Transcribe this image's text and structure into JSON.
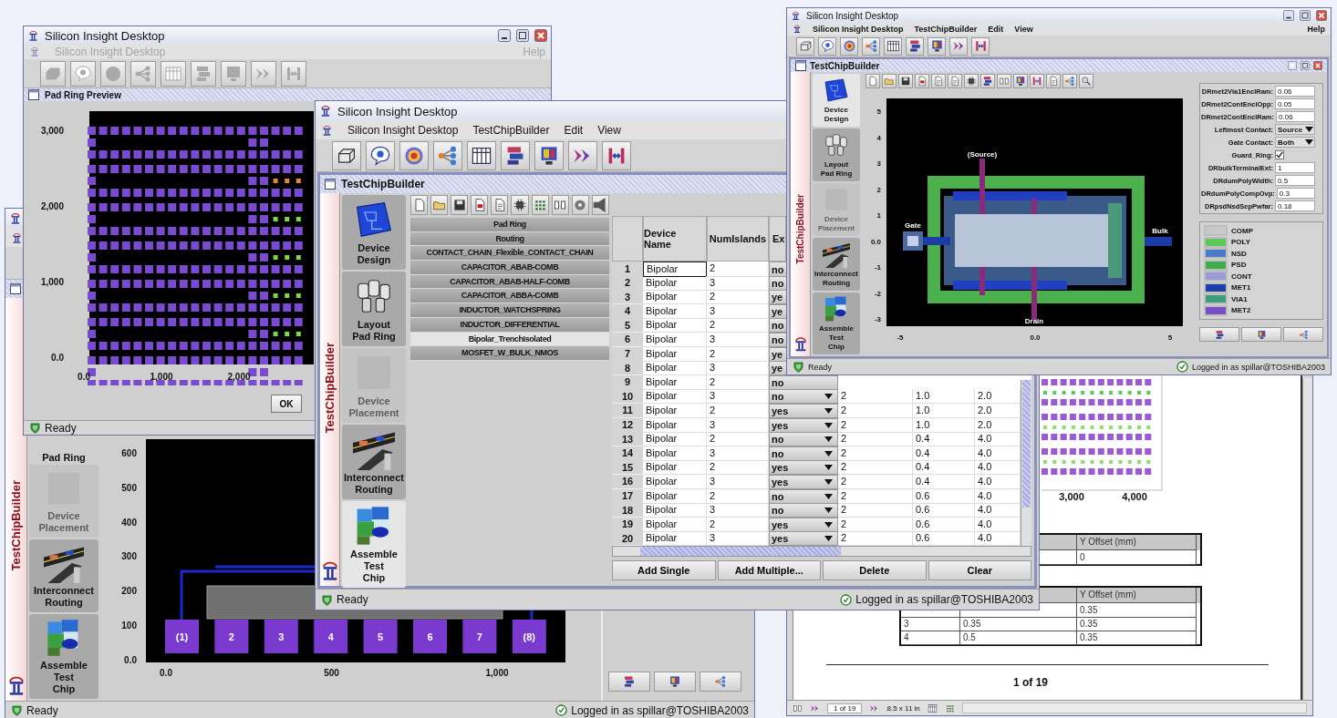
{
  "preview_window": {
    "title": "Silicon Insight Desktop",
    "menubar": {
      "items": [
        "Silicon Insight Desktop"
      ],
      "help": "Help",
      "disabled": true
    },
    "frame_title": "Pad Ring Preview",
    "plot": {
      "yticks": [
        "3,000",
        "2,000",
        "1,000",
        "0.0"
      ],
      "xticks": [
        "0.0",
        "1,000",
        "2,000"
      ]
    },
    "ok": "OK",
    "status": "Ready"
  },
  "builder_window": {
    "title": "Silicon Insight Desktop",
    "menubar": {
      "items": [
        "Silicon Insight Desktop",
        "TestChipBuilder",
        "Edit",
        "View"
      ]
    },
    "frame_title": "TestChipBuilder",
    "sidebar_title": "TestChipBuilder",
    "nav": [
      {
        "kind": "design",
        "label": "Device\nDesign",
        "selected": false,
        "disabled": false
      },
      {
        "kind": "padring",
        "label": "Layout\nPad Ring",
        "selected": false,
        "disabled": false
      },
      {
        "kind": "placement",
        "label": "Device\nPlacement",
        "selected": false,
        "disabled": true
      },
      {
        "kind": "routing",
        "label": "Interconnect\nRouting",
        "selected": false,
        "disabled": false
      },
      {
        "kind": "assembly",
        "label": "Assemble\nTest\nChip",
        "selected": true,
        "disabled": false
      }
    ],
    "device_list": [
      {
        "label": "Pad Ring",
        "selected": false
      },
      {
        "label": "Routing",
        "selected": false
      },
      {
        "label": "CONTACT_CHAIN_Flexible_CONTACT_CHAIN",
        "selected": false
      },
      {
        "label": "CAPACITOR_ABAB-COMB",
        "selected": false
      },
      {
        "label": "CAPACITOR_ABAB-HALF-COMB",
        "selected": false
      },
      {
        "label": "CAPACITOR_ABBA-COMB",
        "selected": false
      },
      {
        "label": "INDUCTOR_WATCHSPRING",
        "selected": false
      },
      {
        "label": "INDUCTOR_DIFFERENTIAL",
        "selected": false
      },
      {
        "label": "Bipolar_TrenchIsolated",
        "selected": true
      },
      {
        "label": "MOSFET_W_BULK_NMOS",
        "selected": false
      }
    ],
    "table": {
      "columns": [
        "Device Name",
        "NumIslands",
        "Ex"
      ],
      "rows": [
        {
          "index": "1",
          "cells": [
            "Bipolar",
            "2",
            "no"
          ],
          "focused": true
        },
        {
          "index": "2",
          "cells": [
            "Bipolar",
            "3",
            "no"
          ],
          "focused": false
        },
        {
          "index": "3",
          "cells": [
            "Bipolar",
            "2",
            "ye"
          ],
          "focused": false
        },
        {
          "index": "4",
          "cells": [
            "Bipolar",
            "3",
            "ye"
          ],
          "focused": false
        },
        {
          "index": "5",
          "cells": [
            "Bipolar",
            "2",
            "no"
          ],
          "focused": false
        },
        {
          "index": "6",
          "cells": [
            "Bipolar",
            "3",
            "no"
          ],
          "focused": false
        },
        {
          "index": "7",
          "cells": [
            "Bipolar",
            "2",
            "ye"
          ],
          "focused": false
        },
        {
          "index": "8",
          "cells": [
            "Bipolar",
            "3",
            "ye"
          ],
          "focused": false
        },
        {
          "index": "9",
          "cells": [
            "Bipolar",
            "2",
            "no"
          ],
          "focused": false
        },
        {
          "index": "10",
          "cells": [
            "Bipolar",
            "3",
            "no",
            "2",
            "1.0",
            "2.0"
          ],
          "focused": false
        },
        {
          "index": "11",
          "cells": [
            "Bipolar",
            "2",
            "yes",
            "2",
            "1.0",
            "2.0"
          ],
          "focused": false
        },
        {
          "index": "12",
          "cells": [
            "Bipolar",
            "3",
            "yes",
            "2",
            "1.0",
            "2.0"
          ],
          "focused": false
        },
        {
          "index": "13",
          "cells": [
            "Bipolar",
            "2",
            "no",
            "2",
            "0.4",
            "4.0"
          ],
          "focused": false
        },
        {
          "index": "14",
          "cells": [
            "Bipolar",
            "3",
            "no",
            "2",
            "0.4",
            "4.0"
          ],
          "focused": false
        },
        {
          "index": "15",
          "cells": [
            "Bipolar",
            "2",
            "yes",
            "2",
            "0.4",
            "4.0"
          ],
          "focused": false
        },
        {
          "index": "16",
          "cells": [
            "Bipolar",
            "3",
            "yes",
            "2",
            "0.4",
            "4.0"
          ],
          "focused": false
        },
        {
          "index": "17",
          "cells": [
            "Bipolar",
            "2",
            "no",
            "2",
            "0.6",
            "4.0"
          ],
          "focused": false
        },
        {
          "index": "18",
          "cells": [
            "Bipolar",
            "3",
            "no",
            "2",
            "0.6",
            "4.0"
          ],
          "focused": false
        },
        {
          "index": "19",
          "cells": [
            "Bipolar",
            "2",
            "yes",
            "2",
            "0.6",
            "4.0"
          ],
          "focused": false
        },
        {
          "index": "20",
          "cells": [
            "Bipolar",
            "3",
            "yes",
            "2",
            "0.6",
            "4.0"
          ],
          "focused": false
        }
      ]
    },
    "buttons": [
      "Add Single",
      "Add Multiple...",
      "Delete",
      "Clear"
    ],
    "status": "Ready",
    "login": "Logged in as spillar@TOSHIBA2003"
  },
  "device_window": {
    "title": "Silicon Insight Desktop",
    "menubar": {
      "items": [
        "Silicon Insight Desktop",
        "TestChipBuilder",
        "Edit",
        "View"
      ],
      "help": "Help"
    },
    "frame_title": "TestChipBuilder",
    "sidebar_title": "TestChipBuilder",
    "nav": [
      {
        "kind": "design",
        "label": "Device\nDesign",
        "selected": true,
        "disabled": false
      },
      {
        "kind": "padring",
        "label": "Layout\nPad Ring",
        "selected": false,
        "disabled": false
      },
      {
        "kind": "placement",
        "label": "Device\nPlacement",
        "selected": false,
        "disabled": true
      },
      {
        "kind": "routing",
        "label": "Interconnect\nRouting",
        "selected": false,
        "disabled": false
      },
      {
        "kind": "assembly",
        "label": "Assemble\nTest\nChip",
        "selected": false,
        "disabled": false
      }
    ],
    "plot": {
      "yticks": [
        "5",
        "4",
        "3",
        "2",
        "1",
        "0.0",
        "-1",
        "-2",
        "-3"
      ],
      "xticks": [
        "-5",
        "0.0",
        "5"
      ],
      "terminals": [
        "(Source)",
        "Gate",
        "Bulk",
        "Drain"
      ]
    },
    "properties": [
      {
        "kind": "text",
        "label": "DRmet2Via1EnclRam:",
        "value": "0.06"
      },
      {
        "kind": "text",
        "label": "DRmet2ContEnclOpp:",
        "value": "0.05"
      },
      {
        "kind": "text",
        "label": "DRmet2ContEnclRam:",
        "value": "0.06"
      },
      {
        "kind": "choice",
        "label": "Leftmost Contact:",
        "value": "Source"
      },
      {
        "kind": "choice",
        "label": "Gate Contact:",
        "value": "Both"
      },
      {
        "kind": "check",
        "label": "Guard_Ring:",
        "checked": true
      },
      {
        "kind": "text",
        "label": "DRbulkTerminalExt:",
        "value": "1"
      },
      {
        "kind": "text",
        "label": "DRdumPolyWidth:",
        "value": "0.5"
      },
      {
        "kind": "text",
        "label": "DRdumPolyCompOvp:",
        "value": "0.3"
      },
      {
        "kind": "text",
        "label": "DRpsdNsdSepPwfar:",
        "value": "0.18"
      }
    ],
    "layers": [
      {
        "name": "COMP",
        "color": "#c8c8c8"
      },
      {
        "name": "POLY",
        "color": "#5cc85c"
      },
      {
        "name": "NSD",
        "color": "#4a7ac8"
      },
      {
        "name": "PSD",
        "color": "#3cae4c"
      },
      {
        "name": "CONT",
        "color": "#9a9ad8"
      },
      {
        "name": "MET1",
        "color": "#1c3ca8"
      },
      {
        "name": "VIA1",
        "color": "#3c9c7c"
      },
      {
        "name": "MET2",
        "color": "#7a4cc8"
      }
    ],
    "status": "Ready",
    "login": "Logged in as spillar@TOSHIBA2003"
  },
  "layout_window": {
    "sidebar_title": "TestChipBuilder",
    "nav_partial": "Pad Ring",
    "nav": [
      {
        "kind": "placement",
        "label": "Device\nPlacement",
        "selected": false,
        "disabled": true
      },
      {
        "kind": "routing",
        "label": "Interconnect\nRouting",
        "selected": false,
        "disabled": false
      },
      {
        "kind": "assembly",
        "label": "Assemble\nTest\nChip",
        "selected": false,
        "disabled": false
      }
    ],
    "plot": {
      "yticks": [
        "600",
        "500",
        "400",
        "300",
        "200",
        "100",
        "0.0"
      ],
      "xticks": [
        "0.0",
        "500",
        "1,000"
      ],
      "pads": [
        "(1)",
        "2",
        "3",
        "4",
        "5",
        "6",
        "7",
        "(8)"
      ]
    },
    "status": "Ready",
    "login": "Logged in as spillar@TOSHIBA2003"
  },
  "report_window": {
    "chart_labels": [
      "3,000",
      "4,000"
    ],
    "tables": [
      {
        "header": {
          "column_3": "Y Offset (mm)"
        },
        "rows": [
          {
            "column_3": "0"
          }
        ]
      },
      {
        "header": {
          "column_3": "Y Offset (mm)"
        },
        "rows": [
          {
            "column_3": "0.35"
          },
          {
            "column_1": "3",
            "column_2": "0.35",
            "column_3": "0.35"
          },
          {
            "column_1": "4",
            "column_2": "0.5",
            "column_3": "0.35"
          }
        ]
      }
    ],
    "page_label": "1 of 19",
    "nav_bar": {
      "page": "1 of 19",
      "size": "8.5 x 11 in"
    }
  }
}
